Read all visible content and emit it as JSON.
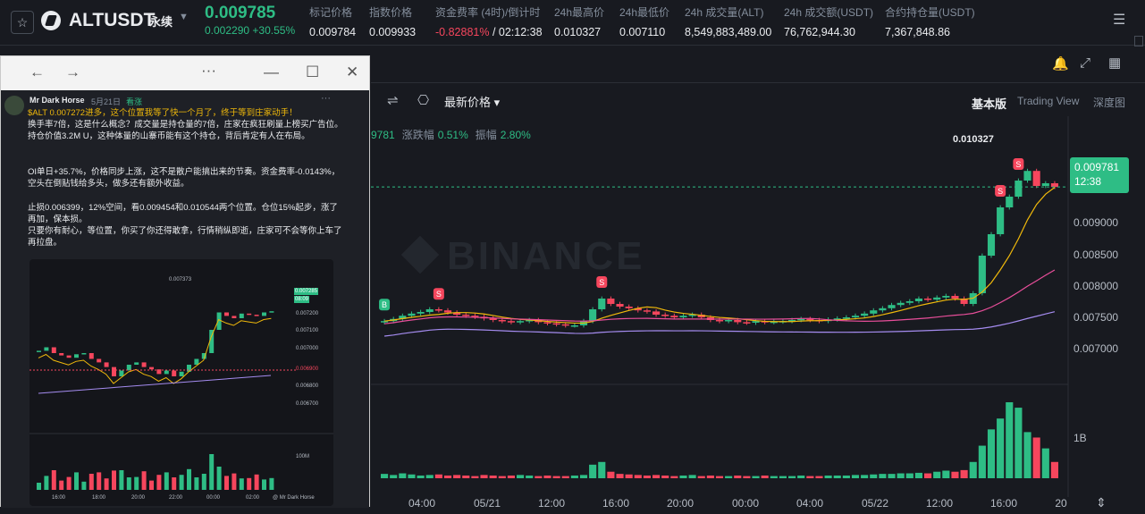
{
  "header": {
    "symbol": "ALTUSDT",
    "contract": "永续",
    "last_price": "0.009785",
    "change": "0.002290",
    "change_pct": "+30.55%",
    "stats": [
      {
        "label": "标记价格",
        "value": "0.009784"
      },
      {
        "label": "指数价格",
        "value": "0.009933"
      },
      {
        "label": "资金费率 (4时)/倒计时",
        "value": "-0.82881%",
        "extra": "/ 02:12:38"
      },
      {
        "label": "24h最高价",
        "value": "0.010327"
      },
      {
        "label": "24h最低价",
        "value": "0.007110"
      },
      {
        "label": "24h 成交量(ALT)",
        "value": "8,549,883,489.00"
      },
      {
        "label": "24h 成交额(USDT)",
        "value": "76,762,944.30"
      },
      {
        "label": "合约持仓量(USDT)",
        "value": "7,367,848.86"
      }
    ]
  },
  "toolbar": {
    "price_type": "最新价格",
    "views": [
      "基本版",
      "Trading View",
      "深度图"
    ]
  },
  "chart_info": {
    "ohlc_fragment": "9781",
    "change_label": "涨跌幅",
    "change_value": "0.51%",
    "amp_label": "振幅",
    "amp_value": "2.80%"
  },
  "chart_labels": {
    "high_marker": "0.010327",
    "current_price": "0.009781",
    "countdown": "12:38",
    "watermark": "BINANCE",
    "volume_axis": "1B",
    "marker_s": "S",
    "marker_b": "B"
  },
  "chart_data": {
    "type": "candlestick",
    "x_ticks": [
      "04:00",
      "05/21",
      "12:00",
      "16:00",
      "20:00",
      "00:00",
      "04:00",
      "05/22",
      "12:00",
      "16:00",
      "20"
    ],
    "y_ticks": [
      "0.009000",
      "0.008500",
      "0.008000",
      "0.007500",
      "0.007000"
    ],
    "ylim": [
      0.0066,
      0.0106
    ],
    "closes": [
      0.00728,
      0.00732,
      0.00738,
      0.00742,
      0.00745,
      0.0075,
      0.00748,
      0.00744,
      0.0074,
      0.00738,
      0.00736,
      0.00733,
      0.0073,
      0.00728,
      0.00726,
      0.00728,
      0.0073,
      0.00726,
      0.00724,
      0.00722,
      0.0072,
      0.0072,
      0.00728,
      0.0075,
      0.0077,
      0.0076,
      0.00755,
      0.00752,
      0.00748,
      0.00746,
      0.0074,
      0.00738,
      0.00735,
      0.00738,
      0.0074,
      0.00735,
      0.0073,
      0.00728,
      0.0073,
      0.00726,
      0.00725,
      0.00728,
      0.00726,
      0.00727,
      0.00728,
      0.0073,
      0.00732,
      0.0073,
      0.00728,
      0.00731,
      0.00733,
      0.00735,
      0.00738,
      0.00742,
      0.00748,
      0.00752,
      0.00758,
      0.00762,
      0.00765,
      0.0077,
      0.00768,
      0.00772,
      0.00775,
      0.0077,
      0.0076,
      0.0078,
      0.0085,
      0.0089,
      0.0094,
      0.0096,
      0.0099,
      0.01008,
      0.0098,
      0.00985,
      0.00978
    ],
    "volume": [
      8,
      6,
      9,
      7,
      5,
      6,
      7,
      5,
      6,
      5,
      4,
      6,
      5,
      4,
      5,
      6,
      5,
      4,
      5,
      4,
      4,
      5,
      6,
      25,
      30,
      12,
      8,
      7,
      6,
      5,
      6,
      5,
      4,
      5,
      6,
      4,
      5,
      4,
      4,
      5,
      4,
      4,
      5,
      4,
      4,
      4,
      5,
      4,
      4,
      5,
      5,
      5,
      6,
      6,
      7,
      8,
      8,
      9,
      9,
      10,
      9,
      12,
      14,
      12,
      15,
      30,
      60,
      90,
      110,
      140,
      130,
      85,
      75,
      55,
      30
    ],
    "series": [
      {
        "name": "",
        "values": []
      }
    ]
  },
  "post": {
    "author": "Mr Dark Horse",
    "date": "5月21日",
    "tag": "看涨",
    "lines": [
      "$ALT 0.007272进多，这个位置我等了快一个月了，终于等到庄家动手！",
      "换手率7倍，这是什么概念？成交量是持仓量的7倍，庄家在疯狂刷量上榜买广告位。持仓价值3.2M U，这种体量的山寨币能有这个持仓，背后肯定有人在布局。",
      "",
      "OI单日+35.7%，价格同步上涨，这不是散户能搞出来的节奏。资金费率-0.0143%，空头在倒贴钱给多头，做多还有额外收益。",
      "",
      "止损0.006399，12%空间，看0.009454和0.010544两个位置。仓位15%起步，涨了再加，保本损。",
      "只要你有耐心，等位置，你买了你还得敢拿，行情稍纵即逝，庄家可不会等你上车了再拉盘。"
    ],
    "image": {
      "high": "0.007373",
      "tag1": "0.007285",
      "tag2": "08:09",
      "y_ticks": [
        "0.007200",
        "0.007100",
        "0.007000",
        "0.006900",
        "0.006800",
        "0.006700"
      ],
      "vol_tick": "100M",
      "x_ticks": [
        "16:00",
        "18:00",
        "20:00",
        "22:00",
        "00:00",
        "02:00"
      ],
      "credit": "@ Mr Dark Horse"
    }
  }
}
